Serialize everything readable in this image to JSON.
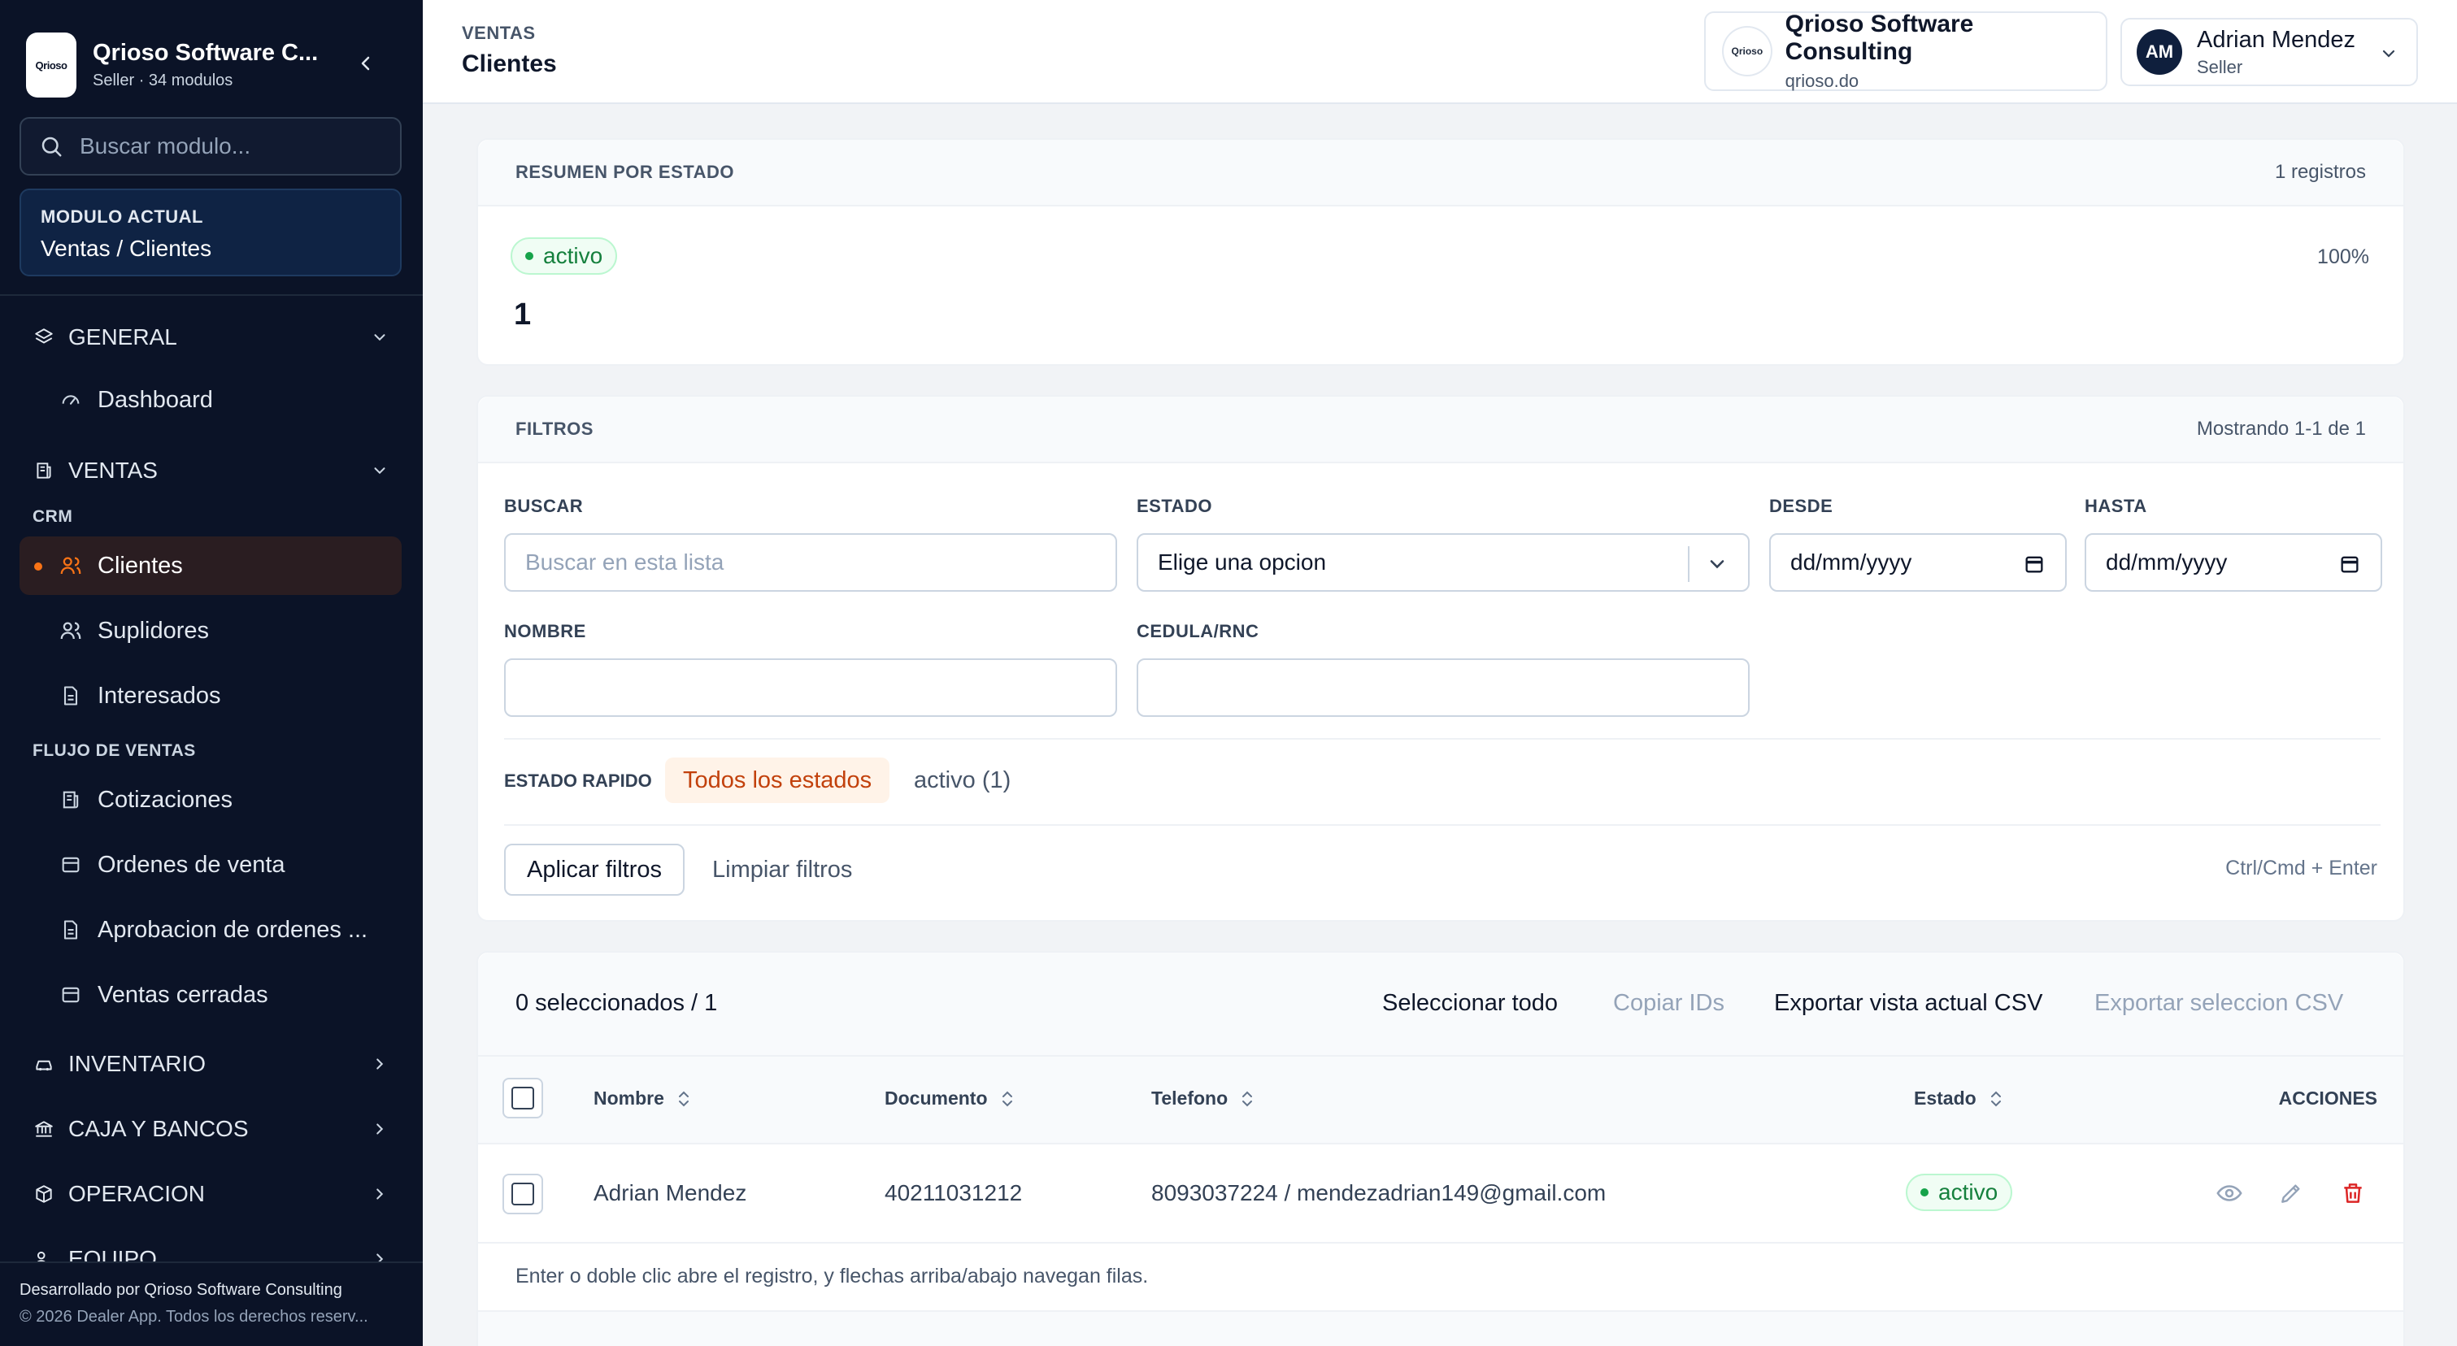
{
  "sidebar": {
    "brand_name": "Qrioso Software C...",
    "brand_sub": "Seller · 34 modulos",
    "brand_logo_text": "Qrioso",
    "search_placeholder": "Buscar modulo...",
    "current_module_label": "MODULO ACTUAL",
    "current_module_value": "Ventas / Clientes",
    "groups": {
      "general": "GENERAL",
      "ventas": "VENTAS",
      "inventario": "INVENTARIO",
      "caja": "CAJA Y BANCOS",
      "operacion": "OPERACION",
      "equipo": "EQUIPO"
    },
    "sub_labels": {
      "crm": "CRM",
      "flujo": "FLUJO DE VENTAS"
    },
    "items": {
      "dashboard": "Dashboard",
      "clientes": "Clientes",
      "suplidores": "Suplidores",
      "interesados": "Interesados",
      "cotizaciones": "Cotizaciones",
      "ordenes": "Ordenes de venta",
      "aprobacion": "Aprobacion de ordenes ...",
      "cerradas": "Ventas cerradas"
    },
    "footer_line1": "Desarrollado por Qrioso Software Consulting",
    "footer_line2": "© 2026 Dealer App. Todos los derechos reserv..."
  },
  "header": {
    "breadcrumb": "VENTAS",
    "title": "Clientes",
    "company_name": "Qrioso Software Consulting",
    "company_domain": "qrioso.do",
    "company_logo_text": "Qrioso",
    "user_initials": "AM",
    "user_name": "Adrian Mendez",
    "user_role": "Seller"
  },
  "summary": {
    "title": "RESUMEN POR ESTADO",
    "records": "1 registros",
    "status": "activo",
    "count": "1",
    "percent": "100%"
  },
  "filters": {
    "title": "FILTROS",
    "showing": "Mostrando 1-1 de 1",
    "buscar_label": "BUSCAR",
    "buscar_placeholder": "Buscar en esta lista",
    "estado_label": "ESTADO",
    "estado_value": "Elige una opcion",
    "desde_label": "DESDE",
    "desde_value": "dd/mm/yyyy",
    "hasta_label": "HASTA",
    "hasta_value": "dd/mm/yyyy",
    "nombre_label": "NOMBRE",
    "cedula_label": "CEDULA/RNC",
    "quick_label": "ESTADO RAPIDO",
    "quick_all": "Todos los estados",
    "quick_activo": "activo (1)",
    "apply": "Aplicar filtros",
    "clear": "Limpiar filtros",
    "shortcut": "Ctrl/Cmd + Enter"
  },
  "table": {
    "selected": "0 seleccionados / 1",
    "select_all": "Seleccionar todo",
    "copy_ids": "Copiar IDs",
    "export_view": "Exportar vista actual CSV",
    "export_selection": "Exportar seleccion CSV",
    "columns": {
      "nombre": "Nombre",
      "documento": "Documento",
      "telefono": "Telefono",
      "estado": "Estado",
      "acciones": "ACCIONES"
    },
    "rows": [
      {
        "nombre": "Adrian Mendez",
        "documento": "40211031212",
        "telefono": "8093037224 / mendezadrian149@gmail.com",
        "estado": "activo"
      }
    ],
    "hint": "Enter o doble clic abre el registro, y flechas arriba/abajo navegan filas."
  },
  "colors": {
    "sidebar_bg": "#0b1327",
    "accent": "#f97316",
    "status_green": "#15803d",
    "danger": "#dc2626"
  }
}
